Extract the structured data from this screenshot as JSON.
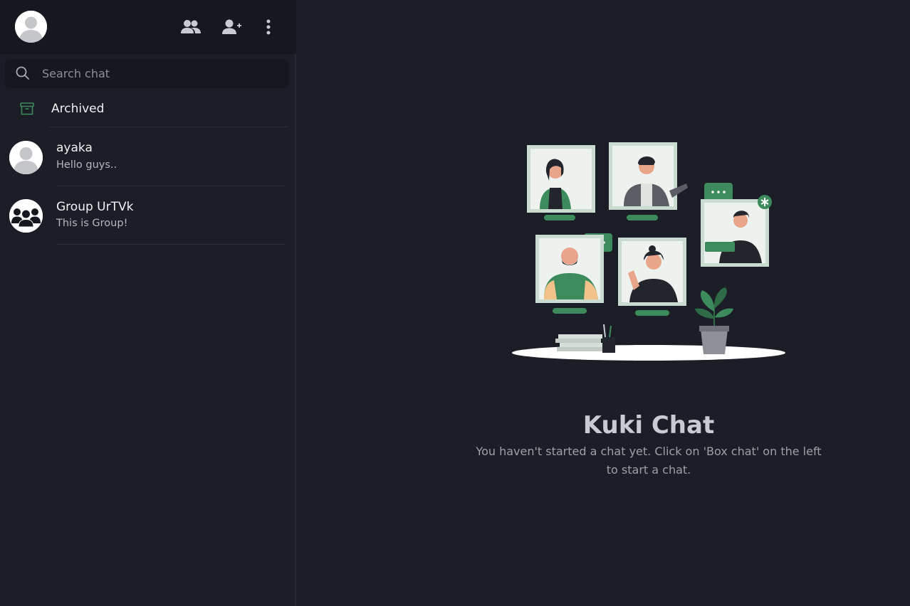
{
  "topbar": {
    "icons": [
      "user-avatar-icon",
      "groups-icon",
      "add-user-icon",
      "more-vertical-icon"
    ]
  },
  "search": {
    "placeholder": "Search chat",
    "value": ""
  },
  "archived": {
    "label": "Archived",
    "icon": "archive-icon"
  },
  "chats": [
    {
      "name": "ayaka",
      "preview": "Hello guys..",
      "avatar": "user-avatar-icon"
    },
    {
      "name": "Group UrTVk",
      "preview": "This is Group!",
      "avatar": "group-avatar-icon"
    }
  ],
  "empty_state": {
    "title": "Kuki Chat",
    "subtitle": "You haven't started a chat yet. Click on 'Box chat' on the left to start a chat."
  },
  "colors": {
    "background": "#1b1e27",
    "topbar": "#16181f",
    "accent_green": "#3d8a5c",
    "text_primary": "#f2f2f2",
    "text_secondary": "#b5b7bc"
  }
}
